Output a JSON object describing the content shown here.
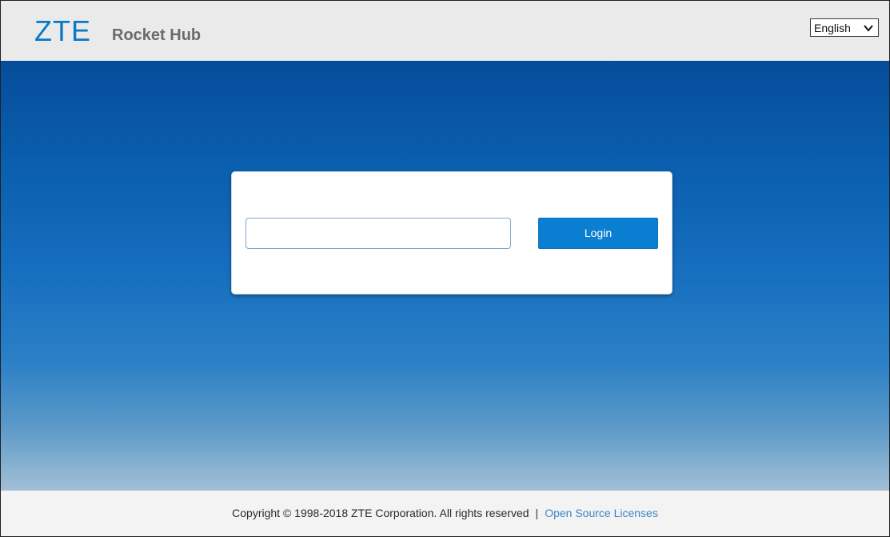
{
  "header": {
    "brand_logo": "ZTE",
    "product_name": "Rocket Hub",
    "language": {
      "selected": "English",
      "icon": "chevron-down-icon"
    }
  },
  "login": {
    "password_value": "",
    "button_label": "Login"
  },
  "footer": {
    "copyright": "Copyright © 1998-2018 ZTE Corporation. All rights reserved",
    "separator": "|",
    "license_link": "Open Source Licenses"
  },
  "colors": {
    "brand": "#0a79c8",
    "button": "#0a7fd2",
    "link": "#3a86c8",
    "header_bg": "#eaeaea",
    "footer_bg": "#f3f3f3"
  }
}
